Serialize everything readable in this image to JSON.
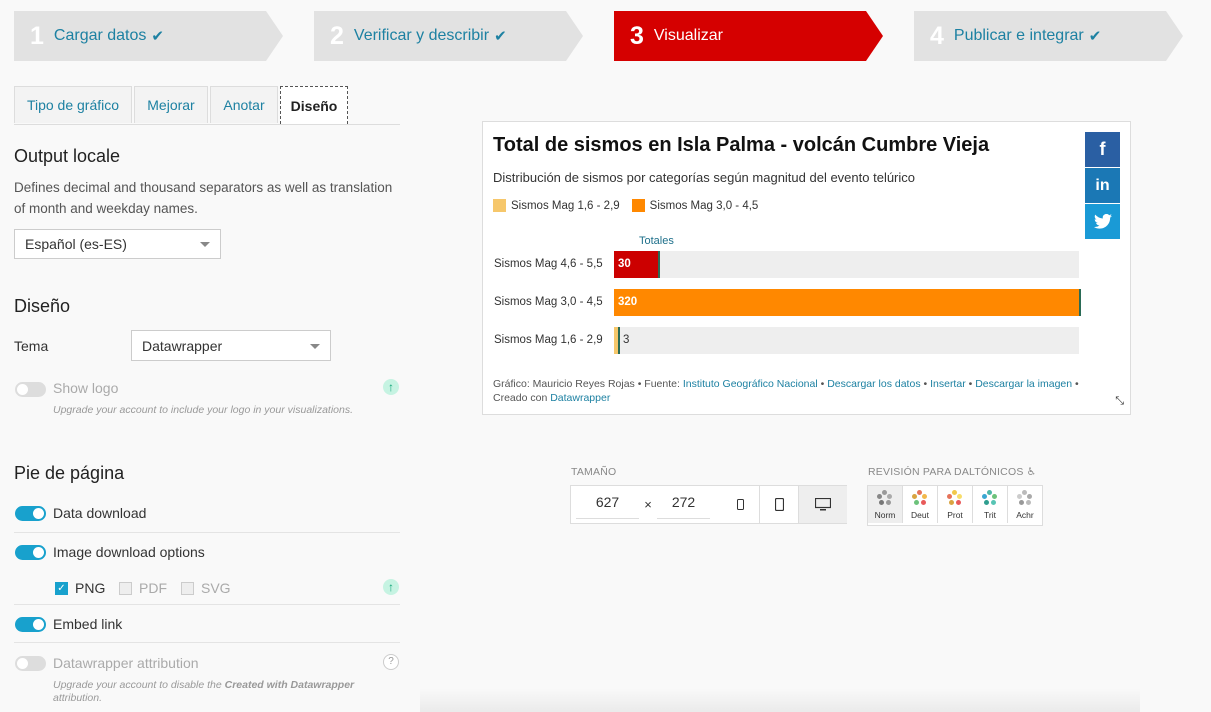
{
  "steps": [
    {
      "num": "1",
      "label": "Cargar datos",
      "done": true
    },
    {
      "num": "2",
      "label": "Verificar y describir",
      "done": true
    },
    {
      "num": "3",
      "label": "Visualizar",
      "done": false
    },
    {
      "num": "4",
      "label": "Publicar e integrar",
      "done": true
    }
  ],
  "tabs": [
    "Tipo de gráfico",
    "Mejorar",
    "Anotar",
    "Diseño"
  ],
  "output_locale": {
    "title": "Output locale",
    "description": "Defines decimal and thousand separators as well as translation of month and weekday names.",
    "selected": "Español (es-ES)"
  },
  "design": {
    "title": "Diseño",
    "theme_label": "Tema",
    "theme_selected": "Datawrapper",
    "show_logo_label": "Show logo",
    "show_logo_hint": "Upgrade your account to include your logo in your visualizations."
  },
  "footer": {
    "title": "Pie de página",
    "data_download": "Data download",
    "image_download": "Image download options",
    "png": "PNG",
    "pdf": "PDF",
    "svg": "SVG",
    "embed_link": "Embed link",
    "attribution": "Datawrapper attribution",
    "attribution_hint_1": "Upgrade your account to disable the ",
    "attribution_hint_em": "Created with Datawrapper",
    "attribution_hint_2": " attribution."
  },
  "chart": {
    "title": "Total de sismos en Isla Palma - volcán Cumbre Vieja",
    "subtitle": "Distribución de sismos por categorías según magnitud del evento telúrico",
    "column_header": "Totales",
    "credits": {
      "source_prefix": "Gráfico: Mauricio Reyes Rojas • Fuente: ",
      "source_link": "Instituto Geográfico Nacional",
      "download_data": "Descargar los datos",
      "embed": "Insertar",
      "download_image": "Descargar la imagen",
      "created_prefix": "Creado con ",
      "created_link": "Datawrapper"
    },
    "social": [
      "f",
      "in",
      "t"
    ]
  },
  "chart_data": {
    "type": "bar",
    "title": "Total de sismos en Isla Palma - volcán Cumbre Vieja",
    "subtitle": "Distribución de sismos por categorías según magnitud del evento telúrico",
    "categories": [
      "Sismos Mag 4,6 - 5,5",
      "Sismos Mag 3,0 - 4,5",
      "Sismos Mag 1,6 - 2,9"
    ],
    "values": [
      30,
      320,
      3
    ],
    "colors": [
      "#cc0000",
      "#ff8800",
      "#f6c76b"
    ],
    "legend": [
      {
        "name": "Sismos Mag 1,6 - 2,9",
        "color": "#f6c76b"
      },
      {
        "name": "Sismos Mag 3,0 - 4,5",
        "color": "#ff8800"
      }
    ],
    "xlim": [
      0,
      320
    ],
    "orientation": "horizontal"
  },
  "size": {
    "caption": "TAMAÑO",
    "width": "627",
    "times": "×",
    "height": "272"
  },
  "colorblind": {
    "caption": "REVISIÓN PARA DALTÓNICOS",
    "modes": [
      "Norm",
      "Deut",
      "Prot",
      "Trit",
      "Achr"
    ]
  }
}
